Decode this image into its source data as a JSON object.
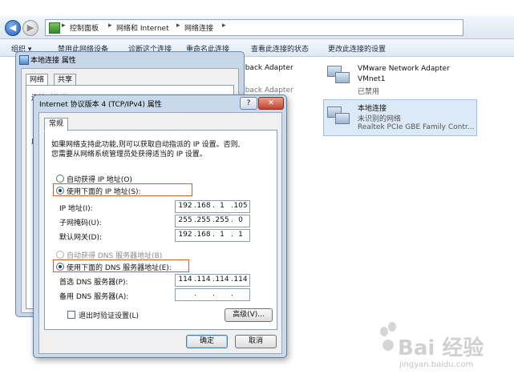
{
  "breadcrumb": [
    "控制面板",
    "网络和 Internet",
    "网络连接"
  ],
  "breadcrumb_sep": "▸",
  "commands": [
    "组织 ▾",
    "禁用此网络设备",
    "诊断这个连接",
    "重命名此连接",
    "查看此连接的状态",
    "更改此连接的设置"
  ],
  "connections_left": [
    "pback Adapter",
    "pback Adapter"
  ],
  "connections": [
    {
      "name": "VMware Network Adapter",
      "line2": "VMnet1",
      "line3": "已禁用"
    },
    {
      "name": "本地连接",
      "line2": "未识别的网络",
      "line3": "Realtek PCIe GBE Family Contr..."
    }
  ],
  "props_dialog": {
    "title": "本地连接 属性",
    "tabs": [
      "网络",
      "共享"
    ],
    "row1": "连接时使用:",
    "row2": "此"
  },
  "tcp_dialog": {
    "title": "Internet 协议版本 4 (TCP/IPv4) 属性",
    "help": "?",
    "close": "✕",
    "tab": "常规",
    "desc1": "如果网络支持此功能,则可以获取自动指派的 IP 设置。否则,",
    "desc2": "您需要从网络系统管理员处获得适当的 IP 设置。",
    "auto_ip": "自动获得 IP 地址(O)",
    "manual_ip": "使用下面的 IP 地址(S):",
    "ip_label": "IP 地址(I):",
    "mask_label": "子网掩码(U):",
    "gw_label": "默认网关(D):",
    "ip": [
      "192",
      "168",
      "1",
      "105"
    ],
    "mask": [
      "255",
      "255",
      "255",
      "0"
    ],
    "gateway": [
      "192",
      "168",
      "1",
      "1"
    ],
    "auto_dns": "自动获得 DNS 服务器地址(B)",
    "manual_dns": "使用下面的 DNS 服务器地址(E):",
    "dns1_label": "首选 DNS 服务器(P):",
    "dns2_label": "备用 DNS 服务器(A):",
    "dns1": [
      "114",
      "114",
      "114",
      "114"
    ],
    "dns2": [
      "",
      "",
      "",
      ""
    ],
    "dot": ".",
    "validate": "退出时验证设置(L)",
    "advanced": "高级(V)...",
    "ok": "确定",
    "cancel": "取消"
  },
  "watermark": {
    "text": "Bai 经验",
    "url": "jingyan.baidu.com"
  },
  "colors": {
    "highlight": "#d45a3a",
    "accent": "#3c7fb1"
  }
}
